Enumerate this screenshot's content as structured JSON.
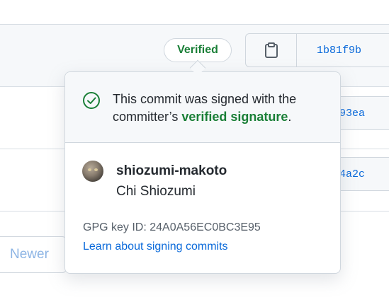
{
  "verified_badge": {
    "label": "Verified"
  },
  "commit_buttons": {
    "copy_icon": "clipboard-icon",
    "sha": "1b81f9b"
  },
  "partial_shas": [
    "93ea",
    "4a2c"
  ],
  "pagination": {
    "newer_label": "Newer"
  },
  "popover": {
    "message_start": "This commit was signed with the committer’s ",
    "message_link": "verified signature",
    "message_end": ".",
    "check_icon": "check-circle-icon",
    "user": {
      "login": "shiozumi-makoto",
      "name": "Chi Shiozumi",
      "avatar": "cat-avatar"
    },
    "gpg_label": "GPG key ID:",
    "gpg_key": "24A0A56EC0BC3E95",
    "learn_link": "Learn about signing commits"
  },
  "colors": {
    "verified_green": "#1a7f37",
    "link_blue": "#0969da",
    "border": "#d0d7de",
    "muted": "#57606a"
  }
}
